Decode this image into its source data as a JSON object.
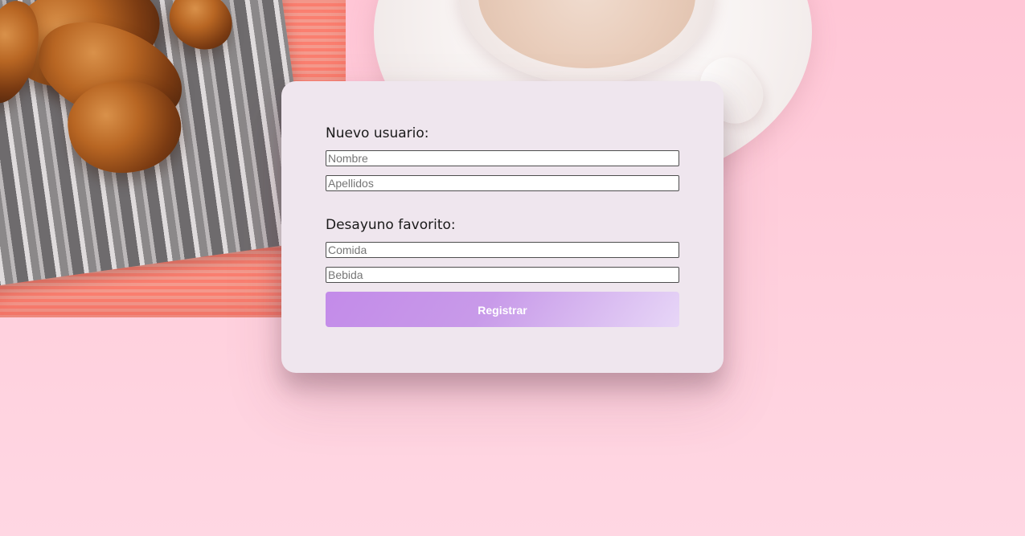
{
  "form": {
    "new_user_label": "Nuevo usuario:",
    "name_placeholder": "Nombre",
    "lastname_placeholder": "Apellidos",
    "breakfast_label": "Desayuno favorito:",
    "food_placeholder": "Comida",
    "drink_placeholder": "Bebida",
    "submit_label": "Registrar"
  },
  "colors": {
    "page_background": "#ffc6d6",
    "card_background": "#efe6ee",
    "button_start": "#c38be9",
    "button_end": "#e7d6f7"
  }
}
